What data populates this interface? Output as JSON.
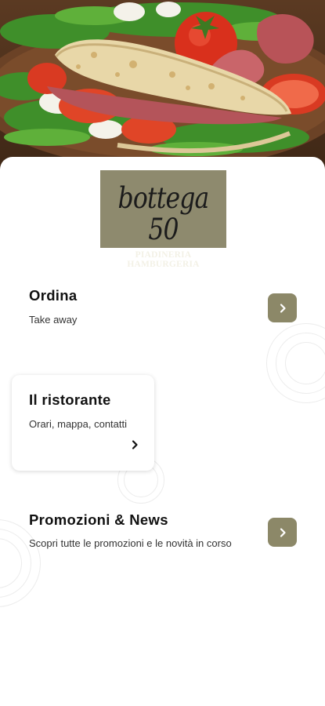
{
  "hero": {
    "image": "piadina-with-prosciutto-tomato-rocket"
  },
  "logo": {
    "script_text": "bottega 50",
    "subtitle": "PIADINERIA HAMBURGERIA",
    "background": "#8e8a6e"
  },
  "menu": {
    "items": [
      {
        "title": "Ordina",
        "subtitle": "Take away",
        "icon": "chevron-right-icon"
      },
      {
        "title": "Il ristorante",
        "subtitle": "Orari, mappa, contatti",
        "icon": "chevron-right-icon"
      },
      {
        "title": "Promozioni & News",
        "subtitle": "Scopri tutte le promozioni e le novità in corso",
        "icon": "chevron-right-icon"
      }
    ]
  },
  "colors": {
    "accent": "#8c8868",
    "text": "#111111",
    "subtext": "#333333"
  }
}
